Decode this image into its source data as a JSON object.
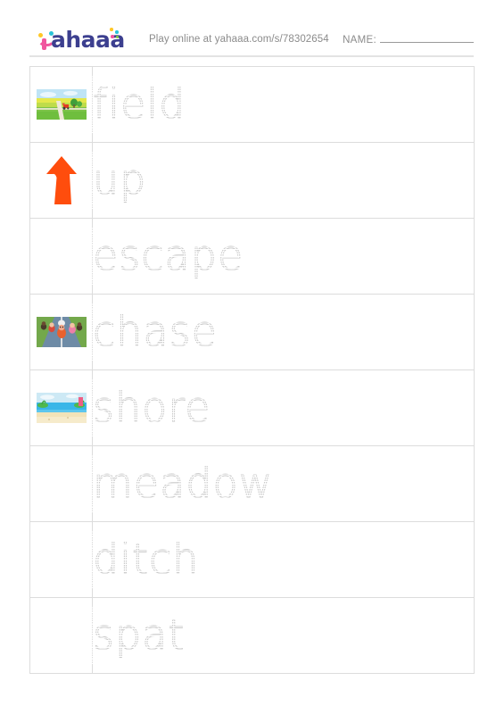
{
  "header": {
    "logo_text": "ahaaa",
    "logo_mark": "y-smiley-mark",
    "play_online": "Play online at yahaaa.com/s/78302654",
    "name_label": "NAME:",
    "name_value": ""
  },
  "colors": {
    "logo_pink": "#F0559E",
    "logo_navy": "#3C3F8F",
    "logo_yellow": "#FFC727",
    "logo_teal": "#29C3D8",
    "arrow_orange": "#FF4D0D",
    "border": "#DCDCDC",
    "trace_gray": "#C9C9C9",
    "muted_text": "#8B8B8B"
  },
  "worksheet": {
    "type": "tracing-worksheet",
    "rows": [
      {
        "word": "field",
        "image": "farm-field-landscape",
        "has_image": true
      },
      {
        "word": "up",
        "image": "orange-up-arrow",
        "has_image": true
      },
      {
        "word": "escape",
        "image": "",
        "has_image": false
      },
      {
        "word": "chase",
        "image": "runners-on-road-chase",
        "has_image": true
      },
      {
        "word": "shore",
        "image": "beach-shore-landscape",
        "has_image": true
      },
      {
        "word": "meadow",
        "image": "",
        "has_image": false
      },
      {
        "word": "ditch",
        "image": "",
        "has_image": false
      },
      {
        "word": "spat",
        "image": "",
        "has_image": false
      }
    ]
  }
}
